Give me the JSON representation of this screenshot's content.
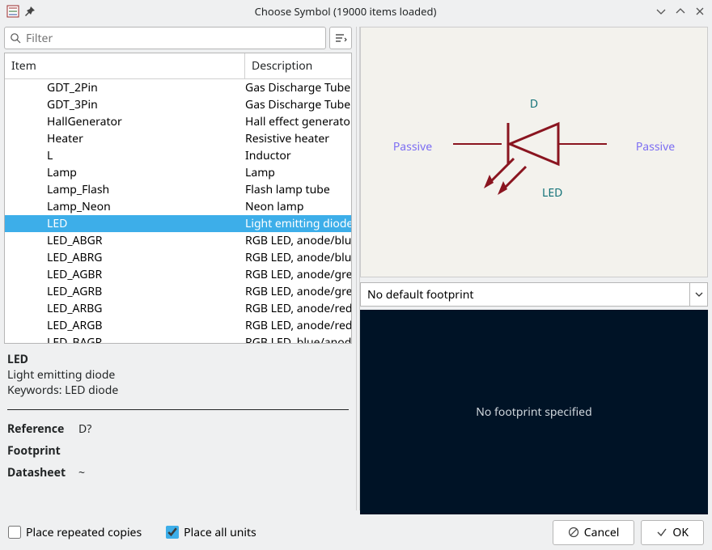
{
  "window": {
    "title": "Choose Symbol (19000 items loaded)"
  },
  "filter": {
    "placeholder": "Filter"
  },
  "tree": {
    "headers": {
      "item": "Item",
      "description": "Description"
    },
    "rows": [
      {
        "item": "GDT_2Pin",
        "desc": "Gas Discharge Tube with two pins",
        "sel": false
      },
      {
        "item": "GDT_3Pin",
        "desc": "Gas Discharge Tube with three pins",
        "sel": false
      },
      {
        "item": "HallGenerator",
        "desc": "Hall effect generator sensor",
        "sel": false
      },
      {
        "item": "Heater",
        "desc": "Resistive heater",
        "sel": false
      },
      {
        "item": "L",
        "desc": "Inductor",
        "sel": false
      },
      {
        "item": "Lamp",
        "desc": "Lamp",
        "sel": false
      },
      {
        "item": "Lamp_Flash",
        "desc": "Flash lamp tube",
        "sel": false
      },
      {
        "item": "Lamp_Neon",
        "desc": "Neon lamp",
        "sel": false
      },
      {
        "item": "LED",
        "desc": "Light emitting diode",
        "sel": true
      },
      {
        "item": "LED_ABGR",
        "desc": "RGB LED, anode/blue/green/red",
        "sel": false
      },
      {
        "item": "LED_ABRG",
        "desc": "RGB LED, anode/blue/red/green",
        "sel": false
      },
      {
        "item": "LED_AGBR",
        "desc": "RGB LED, anode/green/blue/red",
        "sel": false
      },
      {
        "item": "LED_AGRB",
        "desc": "RGB LED, anode/green/red/blue",
        "sel": false
      },
      {
        "item": "LED_ARBG",
        "desc": "RGB LED, anode/red/blue/green",
        "sel": false
      },
      {
        "item": "LED_ARGB",
        "desc": "RGB LED, anode/red/green/blue",
        "sel": false
      },
      {
        "item": "LED_BAGR",
        "desc": "RGB LED, blue/anode/green/red",
        "sel": false
      }
    ]
  },
  "details": {
    "name": "LED",
    "description": "Light emitting diode",
    "keywords_label": "Keywords:",
    "keywords": "LED diode",
    "fields": [
      {
        "name": "Reference",
        "value": "D?"
      },
      {
        "name": "Footprint",
        "value": ""
      },
      {
        "name": "Datasheet",
        "value": "~"
      }
    ]
  },
  "preview": {
    "refdes": "D",
    "value": "LED",
    "pin_left": "Passive",
    "pin_right": "Passive",
    "colors": {
      "body": "#8a1520",
      "field": "#0e7076",
      "pin": "#7b6df3"
    }
  },
  "footprint": {
    "selected": "No default footprint",
    "view_text": "No footprint specified"
  },
  "bottom": {
    "place_repeated": "Place repeated copies",
    "place_all_units": "Place all units",
    "cancel": "Cancel",
    "ok": "OK"
  }
}
